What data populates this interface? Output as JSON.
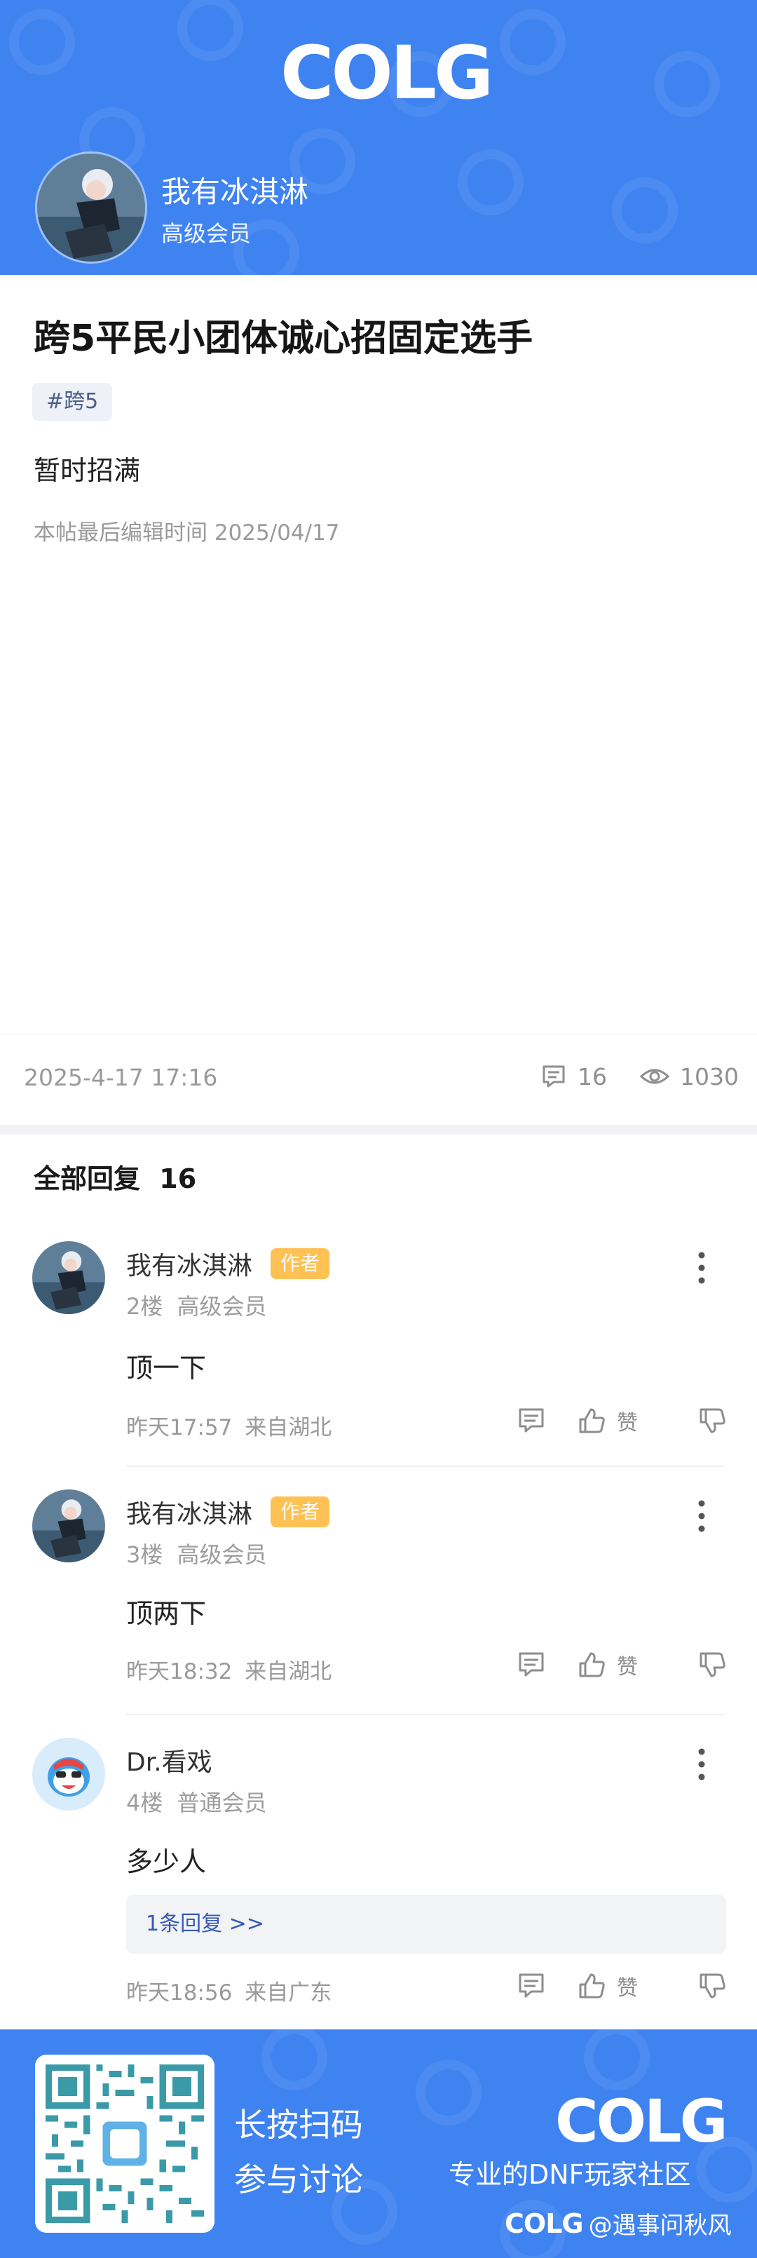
{
  "header": {
    "logo_text": "COLG",
    "author_name": "我有冰淇淋",
    "author_level": "高级会员"
  },
  "post": {
    "title": "跨5平民小团体诚心招固定选手",
    "tag": "#跨5",
    "body": "暂时招满",
    "edit_time": "本帖最后编辑时间 2025/04/17",
    "date": "2025-4-17 17:16",
    "comment_count": "16",
    "view_count": "1030"
  },
  "replies_header": {
    "label": "全部回复",
    "count": "16"
  },
  "labels": {
    "author_badge": "作者",
    "like": "赞"
  },
  "replies": [
    {
      "name": "我有冰淇淋",
      "is_author": true,
      "floor": "2楼",
      "level": "高级会员",
      "text": "顶一下",
      "time": "昨天17:57",
      "location": "来自湖北"
    },
    {
      "name": "我有冰淇淋",
      "is_author": true,
      "floor": "3楼",
      "level": "高级会员",
      "text": "顶两下",
      "time": "昨天18:32",
      "location": "来自湖北"
    },
    {
      "name": "Dr.看戏",
      "is_author": false,
      "floor": "4楼",
      "level": "普通会员",
      "text": "多少人",
      "sub_reply": "1条回复 >>",
      "time": "昨天18:56",
      "location": "来自广东"
    }
  ],
  "footer": {
    "scan_line1": "长按扫码",
    "scan_line2": "参与讨论",
    "logo_text": "COLG",
    "slogan": "专业的DNF玩家社区",
    "credit_logo": "COLG",
    "credit": "@遇事问秋风"
  },
  "colors": {
    "brand_blue": "#3f83f0",
    "author_badge": "#ffc154",
    "link_blue": "#3658b9"
  }
}
